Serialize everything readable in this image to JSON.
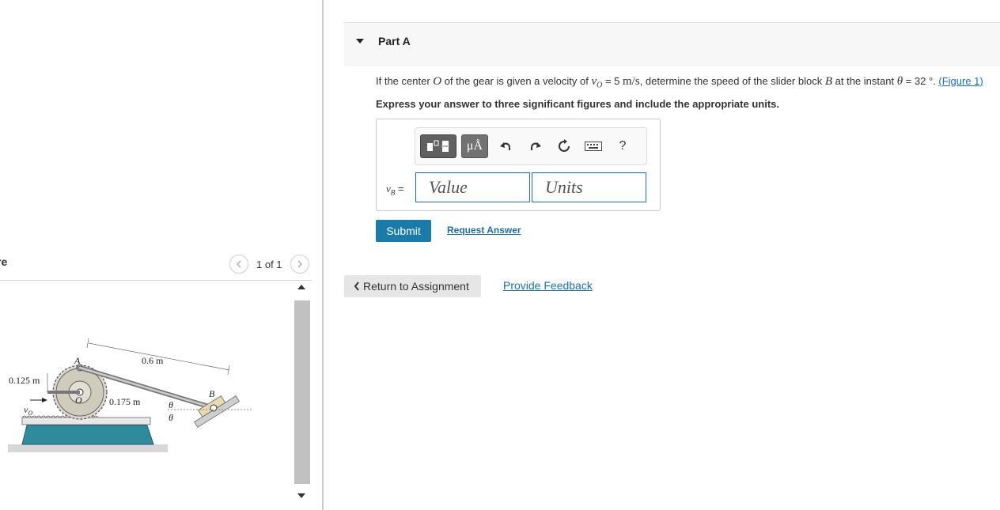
{
  "figure_panel": {
    "title": "re",
    "pager_text": "1 of 1",
    "prev_icon": "chevron-left-icon",
    "next_icon": "chevron-right-icon",
    "labels": {
      "length_ab": "0.6 m",
      "outer_radius": "0.125 m",
      "inner_radius": "0.175 m",
      "point_a": "A",
      "point_b": "B",
      "center_o": "O",
      "velocity": "v",
      "velocity_sub": "O",
      "theta_top": "θ",
      "theta_bottom": "θ"
    }
  },
  "part": {
    "title": "Part A",
    "question_pre": "If the center ",
    "question_o": "O",
    "question_mid1": " of the gear is given a velocity of ",
    "question_v": "v",
    "question_vsub": "O",
    "question_eq": " = 5 ",
    "question_units": "m/s",
    "question_mid2": ", determine the speed of the slider block ",
    "question_b": "B",
    "question_mid3": " at the instant ",
    "question_theta": "θ",
    "question_end": " = 32 °. ",
    "figure_link": "(Figure 1)",
    "instruction": "Express your answer to three significant figures and include the appropriate units."
  },
  "answer": {
    "var_label": "vB =",
    "value_placeholder": "Value",
    "units_placeholder": "Units",
    "toolbar": {
      "units_symbol": "μÅ",
      "help_symbol": "?",
      "icons": [
        "templates-icon",
        "units-icon",
        "undo-icon",
        "redo-icon",
        "reset-icon",
        "keyboard-icon",
        "help-icon"
      ]
    }
  },
  "actions": {
    "submit": "Submit",
    "request_answer": "Request Answer",
    "return": "Return to Assignment",
    "feedback": "Provide Feedback"
  },
  "colors": {
    "link": "#1a6fb5",
    "submit_bg": "#1a7aa8",
    "input_border": "#1a6fb5",
    "base_teal": "#2f8a9c"
  }
}
